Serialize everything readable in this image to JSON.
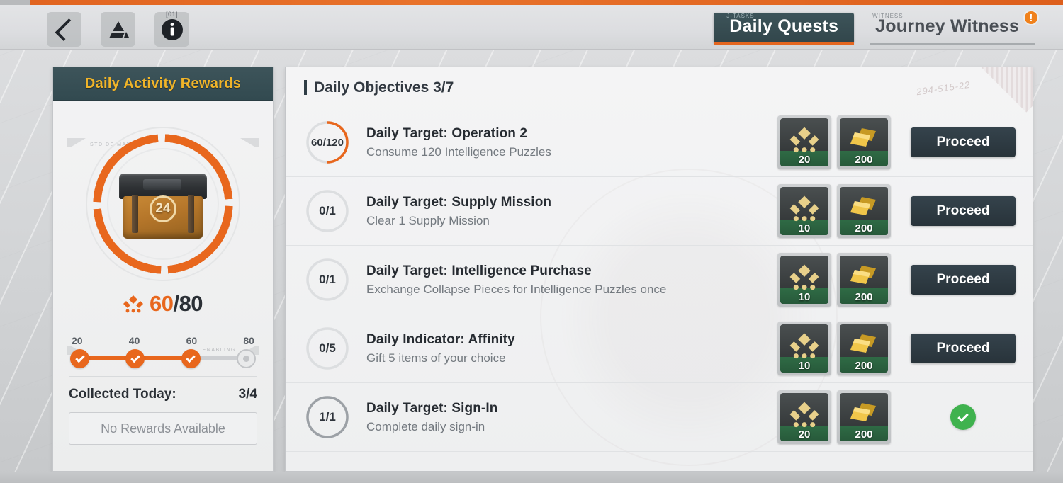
{
  "header": {
    "back_icon": "chevron-left-icon",
    "drive_icon": "drive-icon",
    "info_icon": "info-icon",
    "info_sup": "[01]",
    "tabs": [
      {
        "label": "Daily Quests",
        "sup": "J-TASKS",
        "active": true,
        "badge": ""
      },
      {
        "label": "Journey Witness",
        "sup": "WITNESS",
        "active": false,
        "badge": "!"
      }
    ]
  },
  "left_panel": {
    "title": "Daily Activity Rewards",
    "chest_number": "24",
    "activity": {
      "current": "60",
      "separator": "/",
      "max": "80",
      "emblem_icon": "activity-emblem-icon"
    },
    "mini_labels": {
      "top_left": "STD  DE  MAKA",
      "bottom_right": "ENABLING"
    },
    "milestones": [
      {
        "label": "20",
        "reached": true
      },
      {
        "label": "40",
        "reached": true
      },
      {
        "label": "60",
        "reached": true
      },
      {
        "label": "80",
        "reached": false
      }
    ],
    "collected_label": "Collected Today:",
    "collected_value": "3/4",
    "reward_button": "No Rewards Available"
  },
  "main_panel": {
    "header_title": "Daily Objectives 3/7",
    "corner_scribble": "294-515-22",
    "quests": [
      {
        "progress_text": "60/120",
        "progress_pct": 50,
        "state": "active",
        "title": "Daily Target: Operation 2",
        "desc": "Consume 120 Intelligence Puzzles",
        "rewards": [
          {
            "icon": "activity-emblem-icon",
            "count": "20"
          },
          {
            "icon": "gold-bars-icon",
            "count": "200"
          }
        ],
        "action": {
          "type": "button",
          "label": "Proceed"
        }
      },
      {
        "progress_text": "0/1",
        "progress_pct": 0,
        "state": "empty",
        "title": "Daily Target: Supply Mission",
        "desc": "Clear 1 Supply Mission",
        "rewards": [
          {
            "icon": "activity-emblem-icon",
            "count": "10"
          },
          {
            "icon": "gold-bars-icon",
            "count": "200"
          }
        ],
        "action": {
          "type": "button",
          "label": "Proceed"
        }
      },
      {
        "progress_text": "0/1",
        "progress_pct": 0,
        "state": "empty",
        "title": "Daily Target: Intelligence Purchase",
        "desc": "Exchange Collapse Pieces for Intelligence Puzzles once",
        "rewards": [
          {
            "icon": "activity-emblem-icon",
            "count": "10"
          },
          {
            "icon": "gold-bars-icon",
            "count": "200"
          }
        ],
        "action": {
          "type": "button",
          "label": "Proceed"
        }
      },
      {
        "progress_text": "0/5",
        "progress_pct": 0,
        "state": "empty",
        "title": "Daily Indicator: Affinity",
        "desc": "Gift 5 items of your choice",
        "rewards": [
          {
            "icon": "activity-emblem-icon",
            "count": "10"
          },
          {
            "icon": "gold-bars-icon",
            "count": "200"
          }
        ],
        "action": {
          "type": "button",
          "label": "Proceed"
        }
      },
      {
        "progress_text": "1/1",
        "progress_pct": 100,
        "state": "complete",
        "title": "Daily Target: Sign-In",
        "desc": "Complete daily sign-in",
        "rewards": [
          {
            "icon": "activity-emblem-icon",
            "count": "20"
          },
          {
            "icon": "gold-bars-icon",
            "count": "200"
          }
        ],
        "action": {
          "type": "check",
          "label": "check-icon"
        }
      }
    ]
  },
  "colors": {
    "accent_orange": "#e8671d",
    "panel_header_teal": "#354c52",
    "gold_text": "#f0b429",
    "button_dark": "#2c3840",
    "complete_green": "#3fb24e"
  }
}
